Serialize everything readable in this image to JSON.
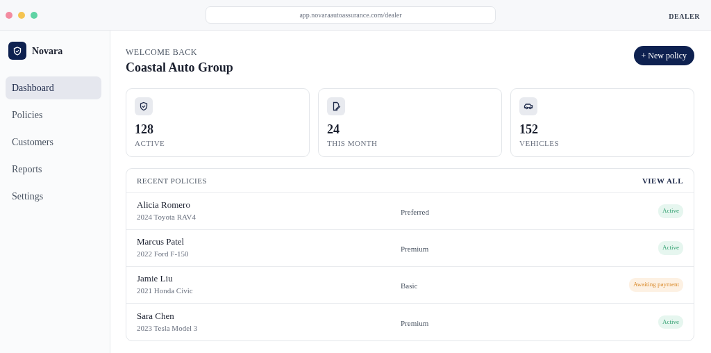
{
  "browser": {
    "url": "app.novaraautoassurance.com/dealer",
    "role": "DEALER"
  },
  "sidebar": {
    "brand": "Novara",
    "items": [
      {
        "label": "Dashboard",
        "selected": true
      },
      {
        "label": "Policies",
        "selected": false
      },
      {
        "label": "Customers",
        "selected": false
      },
      {
        "label": "Reports",
        "selected": false
      },
      {
        "label": "Settings",
        "selected": false
      }
    ]
  },
  "header": {
    "eyebrow": "WELCOME BACK",
    "title": "Coastal Auto Group",
    "button": "+ New policy"
  },
  "stats": [
    {
      "kind": "shield",
      "value": "128",
      "label": "ACTIVE"
    },
    {
      "kind": "document",
      "value": "24",
      "label": "THIS MONTH"
    },
    {
      "kind": "car",
      "value": "152",
      "label": "VEHICLES"
    }
  ],
  "recent": {
    "title": "RECENT POLICIES",
    "link": "VIEW ALL",
    "rows": [
      {
        "name": "Alicia Romero",
        "vehicle": "2024 Toyota RAV4",
        "tier": "Preferred",
        "status": "Active",
        "kind": "active"
      },
      {
        "name": "Marcus Patel",
        "vehicle": "2022 Ford F-150",
        "tier": "Premium",
        "status": "Active",
        "kind": "active"
      },
      {
        "name": "Jamie Liu",
        "vehicle": "2021 Honda Civic",
        "tier": "Basic",
        "status": "Awaiting payment",
        "kind": "pending"
      },
      {
        "name": "Sara Chen",
        "vehicle": "2023 Tesla Model 3",
        "tier": "Premium",
        "status": "Active",
        "kind": "active"
      }
    ]
  }
}
